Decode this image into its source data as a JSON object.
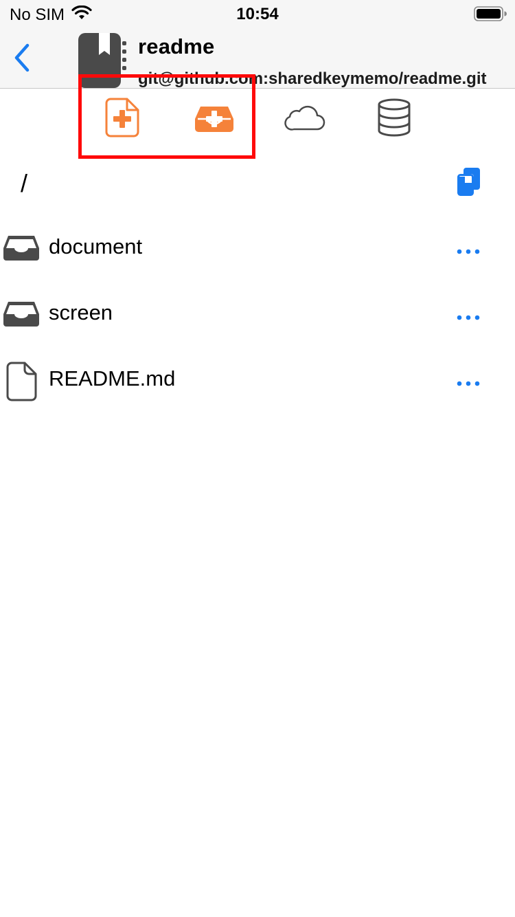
{
  "status_bar": {
    "carrier": "No SIM",
    "time": "10:54",
    "icons": [
      "wifi-icon",
      "battery-icon"
    ]
  },
  "header": {
    "back_icon": "chevron-left-icon",
    "repo_icon": "repository-book-icon",
    "repo_name": "readme",
    "repo_url": "git@github.com:sharedkeymemo/readme.git"
  },
  "toolbar": {
    "tools": [
      {
        "name": "new-file-button",
        "icon": "file-plus-icon"
      },
      {
        "name": "new-folder-button",
        "icon": "tray-plus-icon"
      },
      {
        "name": "cloud-sync-button",
        "icon": "cloud-icon"
      },
      {
        "name": "database-button",
        "icon": "database-icon"
      }
    ],
    "highlight_color": "#ff0a0a"
  },
  "path": {
    "current": "/",
    "copy_icon": "copy-documents-icon"
  },
  "files": [
    {
      "name": "document",
      "type": "folder",
      "icon": "tray-folder-icon"
    },
    {
      "name": "screen",
      "type": "folder",
      "icon": "tray-folder-icon"
    },
    {
      "name": "README.md",
      "type": "file",
      "icon": "document-icon"
    }
  ],
  "colors": {
    "accent": "#1a7cf0",
    "orange": "#f5823a",
    "dark_icon": "#4a4a4a",
    "bar_background": "#f6f6f6"
  }
}
